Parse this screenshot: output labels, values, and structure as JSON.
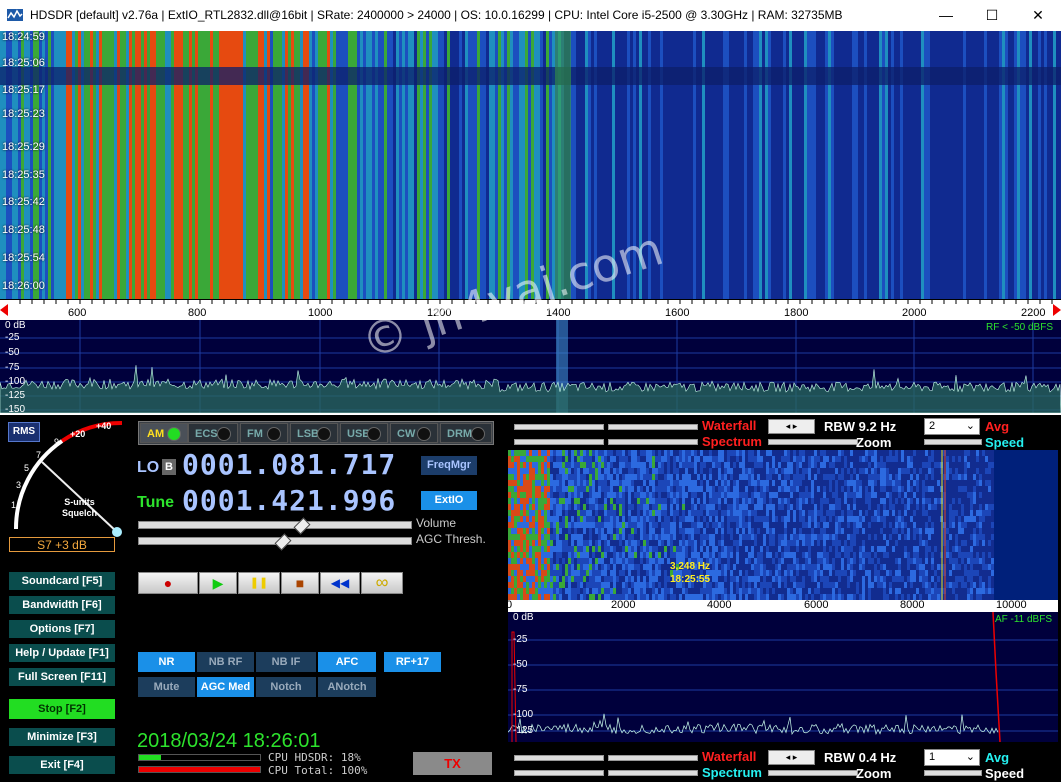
{
  "window": {
    "title": "HDSDR  [default]  v2.76a  |  ExtIO_RTL2832.dll@16bit  |  SRate: 2400000 > 24000  |  OS: 10.0.16299   |  CPU: Intel Core i5-2500 @ 3.30GHz  |  RAM: 32735MB",
    "minimize": "—",
    "maximize": "☐",
    "close": "✕"
  },
  "waterfall_top": {
    "timestamps": [
      "18:24:59",
      "18:25:06",
      "18:25:17",
      "18:25:23",
      "18:25:29",
      "18:25:35",
      "18:25:42",
      "18:25:48",
      "18:25:54",
      "18:26:00"
    ],
    "scale_labels": [
      "600",
      "800",
      "1000",
      "1200",
      "1400",
      "1600",
      "1800",
      "2000",
      "2200"
    ],
    "db_labels": [
      "0 dB",
      "-25",
      "-50",
      "-75",
      "-100",
      "-125",
      "-150"
    ],
    "rf_level": "RF < -50 dBFS"
  },
  "watermark": "© jh4vaj.com",
  "smeter": {
    "rms_label": "RMS",
    "scale": [
      "1",
      "3",
      "5",
      "7",
      "9",
      "+20",
      "+40"
    ],
    "caption": "S-units\nSquelch",
    "caption1": "S-units",
    "caption2": "Squelch",
    "reading": "S7 +3 dB"
  },
  "left_buttons": [
    {
      "label": "Soundcard  [F5]"
    },
    {
      "label": "Bandwidth  [F6]"
    },
    {
      "label": "Options   [F7]"
    },
    {
      "label": "Help / Update  [F1]"
    },
    {
      "label": "Full Screen  [F11]"
    },
    {
      "label": "Stop         [F2]"
    },
    {
      "label": "Minimize  [F3]"
    },
    {
      "label": "Exit         [F4]"
    }
  ],
  "modes": [
    "AM",
    "ECSS",
    "FM",
    "LSB",
    "USB",
    "CW",
    "DRM"
  ],
  "lo": {
    "label": "LO",
    "b_label": "B",
    "value": "0001.081.717"
  },
  "tune": {
    "label": "Tune",
    "value": "0001.421.996"
  },
  "freqmgr": "FreqMgr",
  "extio": "ExtIO",
  "volume_label": "Volume",
  "agc_label": "AGC Thresh.",
  "transport": {
    "record": "●",
    "play": "▶",
    "pause": "❚❚",
    "stop": "■",
    "rewind": "◀◀",
    "loop": "∞"
  },
  "dsp_row1": [
    "NR",
    "NB RF",
    "NB IF",
    "AFC",
    "RF+17"
  ],
  "dsp_row2": [
    "Mute",
    "AGC Med",
    "Notch",
    "ANotch"
  ],
  "datetime": "2018/03/24 18:26:01",
  "cpu": {
    "hdsdr": "CPU HDSDR:  18%",
    "total": "CPU Total: 100%",
    "hdsdr_level": 0.18,
    "total_level": 1.0
  },
  "tx_label": "TX",
  "rf_controls": {
    "waterfall": "Waterfall",
    "spectrum": "Spectrum",
    "rbw": "RBW  9.2 Hz",
    "zoom": "Zoom",
    "avg_value": "2",
    "avg": "Avg",
    "speed": "Speed"
  },
  "af_waterfall": {
    "cursor_freq": "3,248 Hz",
    "cursor_time": "18:25:55",
    "scale_labels": [
      "0",
      "2000",
      "4000",
      "6000",
      "8000",
      "10000"
    ],
    "db_labels": [
      "0 dB",
      "-25",
      "-50",
      "-75",
      "-100",
      "-125"
    ],
    "af_level": "AF -11 dBFS"
  },
  "af_controls": {
    "waterfall": "Waterfall",
    "spectrum": "Spectrum",
    "rbw": "RBW  0.4 Hz",
    "zoom": "Zoom",
    "avg_value": "1",
    "avg": "Avg",
    "speed": "Speed"
  },
  "colors": {
    "rf_level": "#2de32d",
    "digits": "#a9c4ff",
    "tune_label": "#2de32d",
    "stop_button": "#22dd22"
  }
}
